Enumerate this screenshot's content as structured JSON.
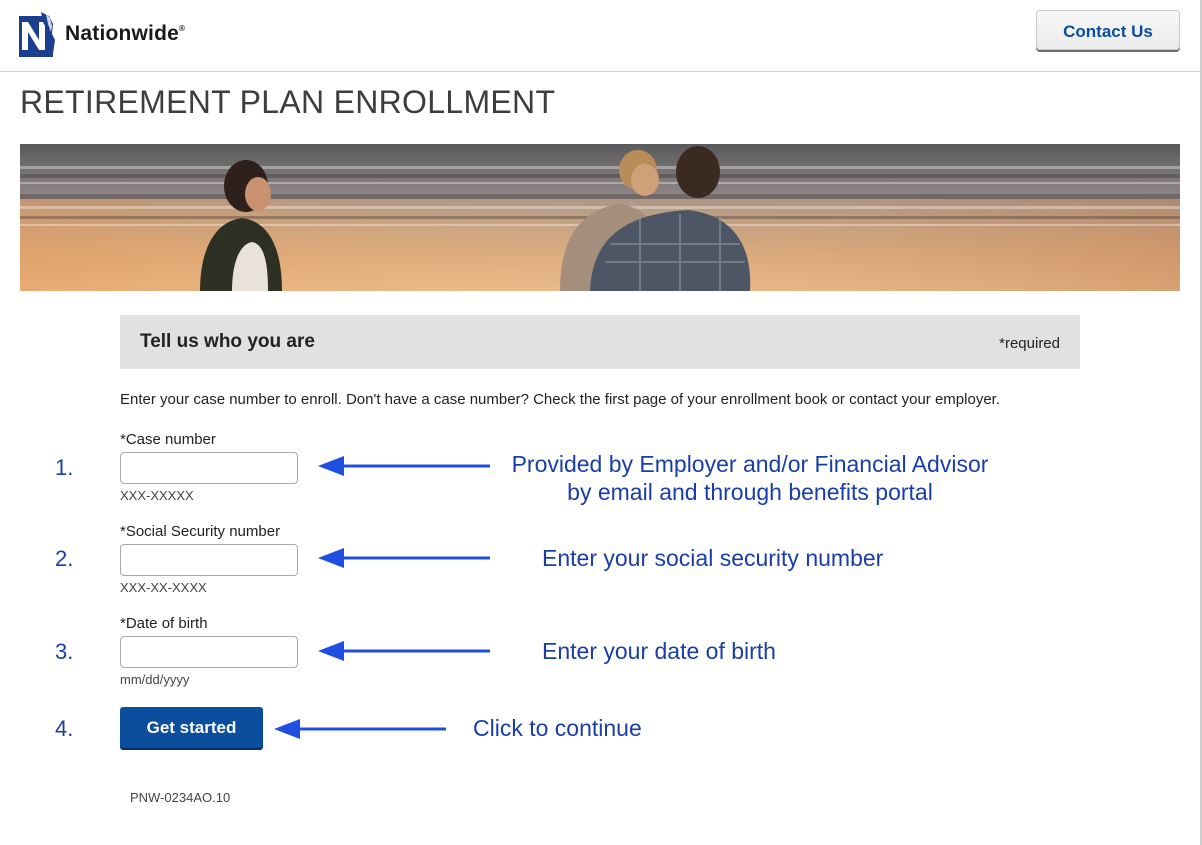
{
  "header": {
    "logo_text": "Nationwide",
    "logo_reg": "®",
    "contact_label": "Contact Us"
  },
  "page": {
    "title": "RETIREMENT PLAN ENROLLMENT"
  },
  "form": {
    "section_title": "Tell us who you are",
    "required_note": "*required",
    "instructions": "Enter your case number to enroll. Don't have a case number? Check the first page of your enrollment book or contact your employer.",
    "fields": [
      {
        "label": "*Case number",
        "hint": "XXX-XXXXX",
        "value": ""
      },
      {
        "label": "*Social Security number",
        "hint": "XXX-XX-XXXX",
        "value": ""
      },
      {
        "label": "*Date of birth",
        "hint": "mm/dd/yyyy",
        "value": ""
      }
    ],
    "submit_label": "Get started",
    "form_code": "PNW-0234AO.10"
  },
  "annotations": {
    "steps": [
      "1.",
      "2.",
      "3.",
      "4."
    ],
    "notes": [
      "Provided by Employer and/or Financial Advisor by email and through benefits portal",
      "Enter your social security number",
      "Enter your date of birth",
      "Click to continue"
    ]
  },
  "colors": {
    "brand_blue": "#0b4e9e",
    "annotation_blue": "#1a3ea8",
    "arrow_blue": "#1f4fe0",
    "section_bg": "#e1e1e1"
  }
}
